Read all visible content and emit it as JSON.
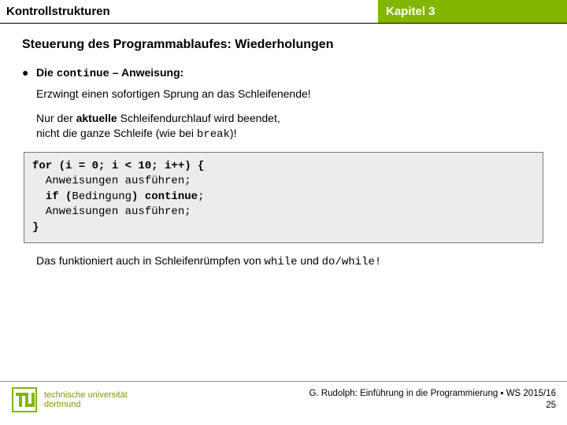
{
  "header": {
    "left": "Kontrollstrukturen",
    "right": "Kapitel 3"
  },
  "section_title": "Steuerung des Programmablaufes: Wiederholungen",
  "bullet": {
    "pre": "Die ",
    "kw": "continue",
    "post": " – Anweisung:"
  },
  "explain1": "Erzwingt einen sofortigen Sprung an das Schleifenende!",
  "explain2a": "Nur der ",
  "explain2b": "aktuelle",
  "explain2c": " Schleifendurchlauf wird beendet,",
  "explain3a": "nicht die ganze Schleife (wie bei ",
  "explain3b": "break",
  "explain3c": ")!",
  "code": {
    "l1a": "for (i = 0; i < 10; i++) {",
    "l2": "  Anweisungen ausführen;",
    "l3a": "  if (",
    "l3b": "Bedingung",
    "l3c": ") ",
    "l3d": "continue",
    "l3e": ";",
    "l4": "  Anweisungen ausführen;",
    "l5": "}"
  },
  "footnote": {
    "a": "Das funktioniert auch in Schleifenrümpfen von ",
    "b": "while",
    "c": " und ",
    "d": "do/while!"
  },
  "logo": {
    "line1": "technische universität",
    "line2": "dortmund"
  },
  "credit": {
    "line1": "G. Rudolph: Einführung in die Programmierung ▪ WS 2015/16",
    "line2": "25"
  }
}
